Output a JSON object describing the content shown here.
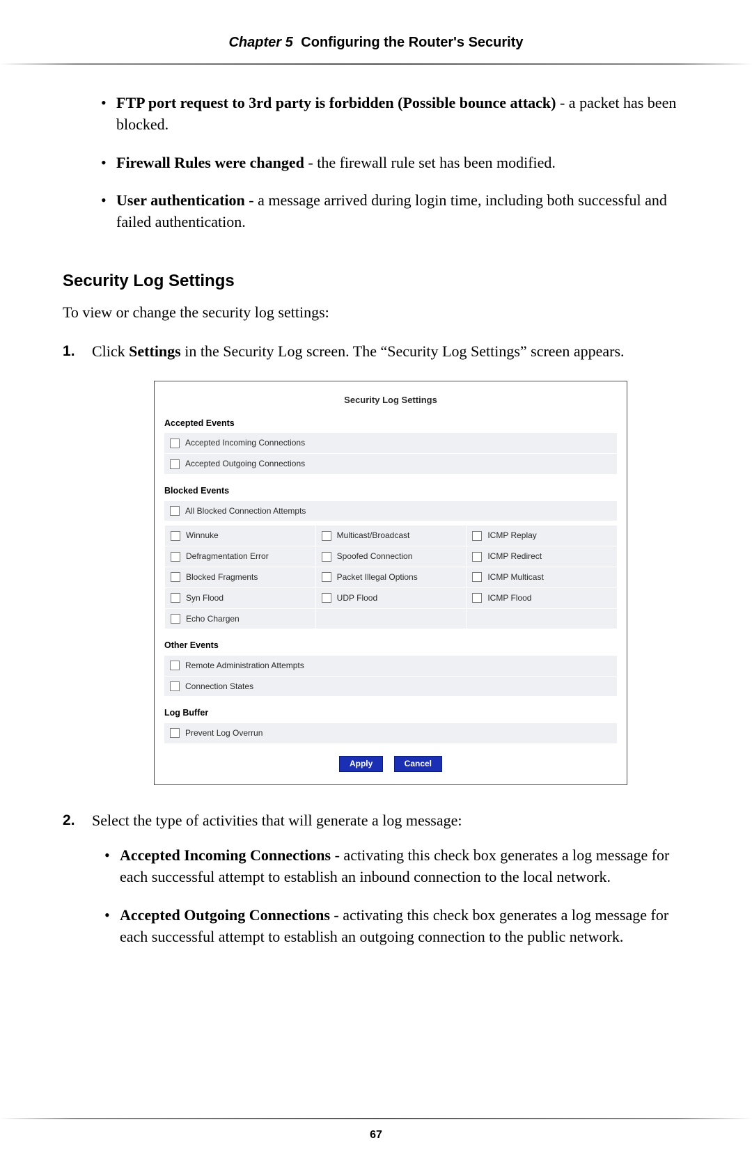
{
  "header": {
    "chapter": "Chapter 5",
    "title": "Configuring the Router's Security"
  },
  "page_number": "67",
  "top_bullets": [
    {
      "bold": "FTP port request to 3rd party is forbidden (Possible bounce attack)",
      "rest": " - a packet has been blocked."
    },
    {
      "bold": "Firewall Rules were changed",
      "rest": " - the firewall rule set has been modified."
    },
    {
      "bold": "User authentication",
      "rest": " - a message arrived during login time, including both successful and failed authentication."
    }
  ],
  "section_heading": "Security Log Settings",
  "intro": "To view or change the security log settings:",
  "step1": {
    "pre": "Click ",
    "bold": "Settings",
    "post": " in the Security Log screen. The “Security Log Settings” screen appears."
  },
  "shot": {
    "title": "Security Log Settings",
    "groups": {
      "accepted": {
        "label": "Accepted Events",
        "items": [
          "Accepted Incoming Connections",
          "Accepted Outgoing Connections"
        ]
      },
      "blocked": {
        "label": "Blocked Events",
        "all": "All Blocked Connection Attempts",
        "col1": [
          "Winnuke",
          "Defragmentation Error",
          "Blocked Fragments",
          "Syn Flood",
          "Echo Chargen"
        ],
        "col2": [
          "Multicast/Broadcast",
          "Spoofed Connection",
          "Packet Illegal Options",
          "UDP Flood",
          ""
        ],
        "col3": [
          "ICMP Replay",
          "ICMP Redirect",
          "ICMP Multicast",
          "ICMP Flood",
          ""
        ]
      },
      "other": {
        "label": "Other Events",
        "items": [
          "Remote Administration Attempts",
          "Connection States"
        ]
      },
      "buffer": {
        "label": "Log Buffer",
        "items": [
          "Prevent Log Overrun"
        ]
      }
    },
    "buttons": {
      "apply": "Apply",
      "cancel": "Cancel"
    }
  },
  "step2": {
    "text": "Select the type of activities that will generate a log message:",
    "subs": [
      {
        "bold": "Accepted Incoming Connections",
        "rest": " - activating this check box generates a log message for each successful attempt to establish an inbound connection to the local network."
      },
      {
        "bold": "Accepted Outgoing Connections",
        "rest": " - activating this check box generates a log message for each successful attempt to establish an outgoing connection to the public network."
      }
    ]
  }
}
